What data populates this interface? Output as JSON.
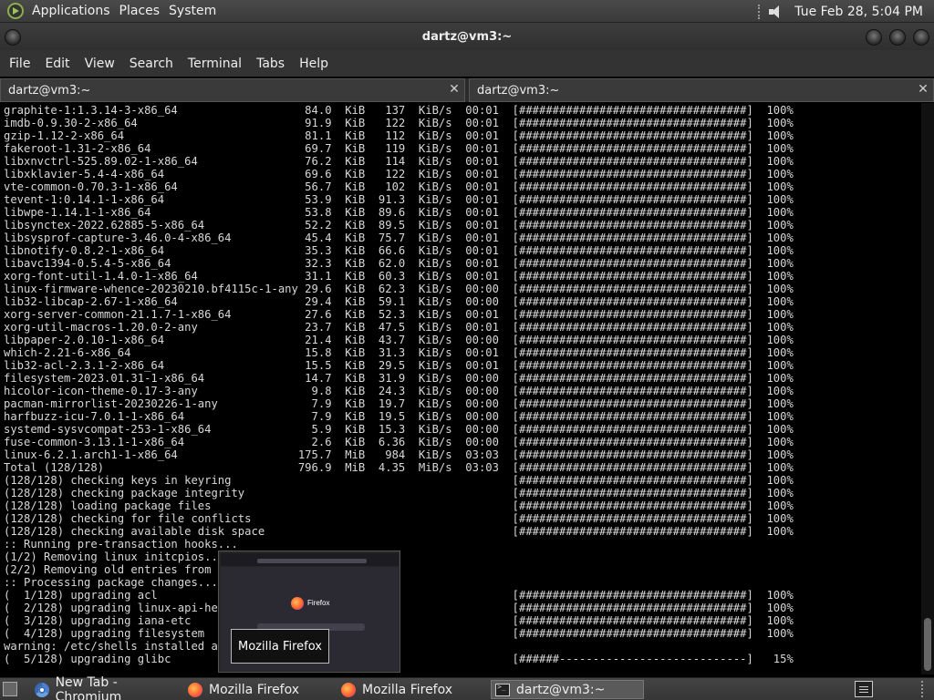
{
  "top_panel": {
    "menus": [
      "Applications",
      "Places",
      "System"
    ],
    "clock": "Tue Feb 28,  5:04 PM"
  },
  "window": {
    "title": "dartz@vm3:~"
  },
  "menubar": [
    "File",
    "Edit",
    "View",
    "Search",
    "Terminal",
    "Tabs",
    "Help"
  ],
  "tabs": [
    {
      "label": "dartz@vm3:~"
    },
    {
      "label": "dartz@vm3:~"
    }
  ],
  "terminal": {
    "lines": [
      "graphite-1:1.3.14-3-x86_64                   84.0  KiB   137  KiB/s  00:01  [##################################]  100%",
      "imdb-0.9.30-2-x86_64                         91.9  KiB   122  KiB/s  00:01  [##################################]  100%",
      "gzip-1.12-2-x86_64                           81.1  KiB   112  KiB/s  00:01  [##################################]  100%",
      "fakeroot-1.31-2-x86_64                       69.7  KiB   119  KiB/s  00:01  [##################################]  100%",
      "libxnvctrl-525.89.02-1-x86_64                76.2  KiB   114  KiB/s  00:01  [##################################]  100%",
      "libxklavier-5.4-4-x86_64                     69.6  KiB   122  KiB/s  00:01  [##################################]  100%",
      "vte-common-0.70.3-1-x86_64                   56.7  KiB   102  KiB/s  00:01  [##################################]  100%",
      "tevent-1:0.14.1-1-x86_64                     53.9  KiB  91.3  KiB/s  00:01  [##################################]  100%",
      "libwpe-1.14.1-1-x86_64                       53.8  KiB  89.6  KiB/s  00:01  [##################################]  100%",
      "libsynctex-2022.62885-5-x86_64               52.2  KiB  89.5  KiB/s  00:01  [##################################]  100%",
      "libsysprof-capture-3.46.0-4-x86_64           45.4  KiB  75.7  KiB/s  00:01  [##################################]  100%",
      "libnotify-0.8.2-1-x86_64                     35.3  KiB  66.6  KiB/s  00:01  [##################################]  100%",
      "libavc1394-0.5.4-5-x86_64                    32.3  KiB  62.0  KiB/s  00:01  [##################################]  100%",
      "xorg-font-util-1.4.0-1-x86_64                31.1  KiB  60.3  KiB/s  00:01  [##################################]  100%",
      "linux-firmware-whence-20230210.bf4115c-1-any 29.6  KiB  62.3  KiB/s  00:00  [##################################]  100%",
      "lib32-libcap-2.67-1-x86_64                   29.4  KiB  59.1  KiB/s  00:00  [##################################]  100%",
      "xorg-server-common-21.1.7-1-x86_64           27.6  KiB  52.3  KiB/s  00:01  [##################################]  100%",
      "xorg-util-macros-1.20.0-2-any                23.7  KiB  47.5  KiB/s  00:01  [##################################]  100%",
      "libpaper-2.0.10-1-x86_64                     21.4  KiB  43.7  KiB/s  00:00  [##################################]  100%",
      "which-2.21-6-x86_64                          15.8  KiB  31.3  KiB/s  00:01  [##################################]  100%",
      "lib32-acl-2.3.1-2-x86_64                     15.5  KiB  29.5  KiB/s  00:01  [##################################]  100%",
      "filesystem-2023.01.31-1-x86_64               14.7  KiB  31.9  KiB/s  00:00  [##################################]  100%",
      "hicolor-icon-theme-0.17-3-any                 9.8  KiB  24.3  KiB/s  00:00  [##################################]  100%",
      "pacman-mirrorlist-20230226-1-any              7.9  KiB  19.7  KiB/s  00:00  [##################################]  100%",
      "harfbuzz-icu-7.0.1-1-x86_64                   7.9  KiB  19.5  KiB/s  00:00  [##################################]  100%",
      "systemd-sysvcompat-253-1-x86_64               5.9  KiB  15.3  KiB/s  00:00  [##################################]  100%",
      "fuse-common-3.13.1-1-x86_64                   2.6  KiB  6.36  KiB/s  00:00  [##################################]  100%",
      "linux-6.2.1.arch1-1-x86_64                  175.7  MiB   984  KiB/s  03:03  [##################################]  100%",
      "Total (128/128)                             796.9  MiB  4.35  MiB/s  03:03  [##################################]  100%",
      "(128/128) checking keys in keyring                                          [##################################]  100%",
      "(128/128) checking package integrity                                        [##################################]  100%",
      "(128/128) loading package files                                             [##################################]  100%",
      "(128/128) checking for file conflicts                                       [##################################]  100%",
      "(128/128) checking available disk space                                     [##################################]  100%",
      ":: Running pre-transaction hooks...",
      "(1/2) Removing linux initcpios...",
      "(2/2) Removing old entries from the info directory file...",
      ":: Processing package changes...",
      "(  1/128) upgrading acl                                                     [##################################]  100%",
      "(  2/128) upgrading linux-api-headers                                       [##################################]  100%",
      "(  3/128) upgrading iana-etc                                                [##################################]  100%",
      "(  4/128) upgrading filesystem                                              [##################################]  100%",
      "warning: /etc/shells installed as /etc/shells.pacnew",
      "(  5/128) upgrading glibc                                                   [######----------------------------]   15%"
    ]
  },
  "preview": {
    "title": "Mozilla Firefox",
    "brand": "Firefox"
  },
  "taskbar": [
    {
      "label": "New Tab - Chromium",
      "icon": "chromium-icon"
    },
    {
      "label": "Mozilla Firefox",
      "icon": "firefox-icon"
    },
    {
      "label": "Mozilla Firefox",
      "icon": "firefox-icon"
    },
    {
      "label": "dartz@vm3:~",
      "icon": "terminal-icon",
      "active": true
    }
  ]
}
